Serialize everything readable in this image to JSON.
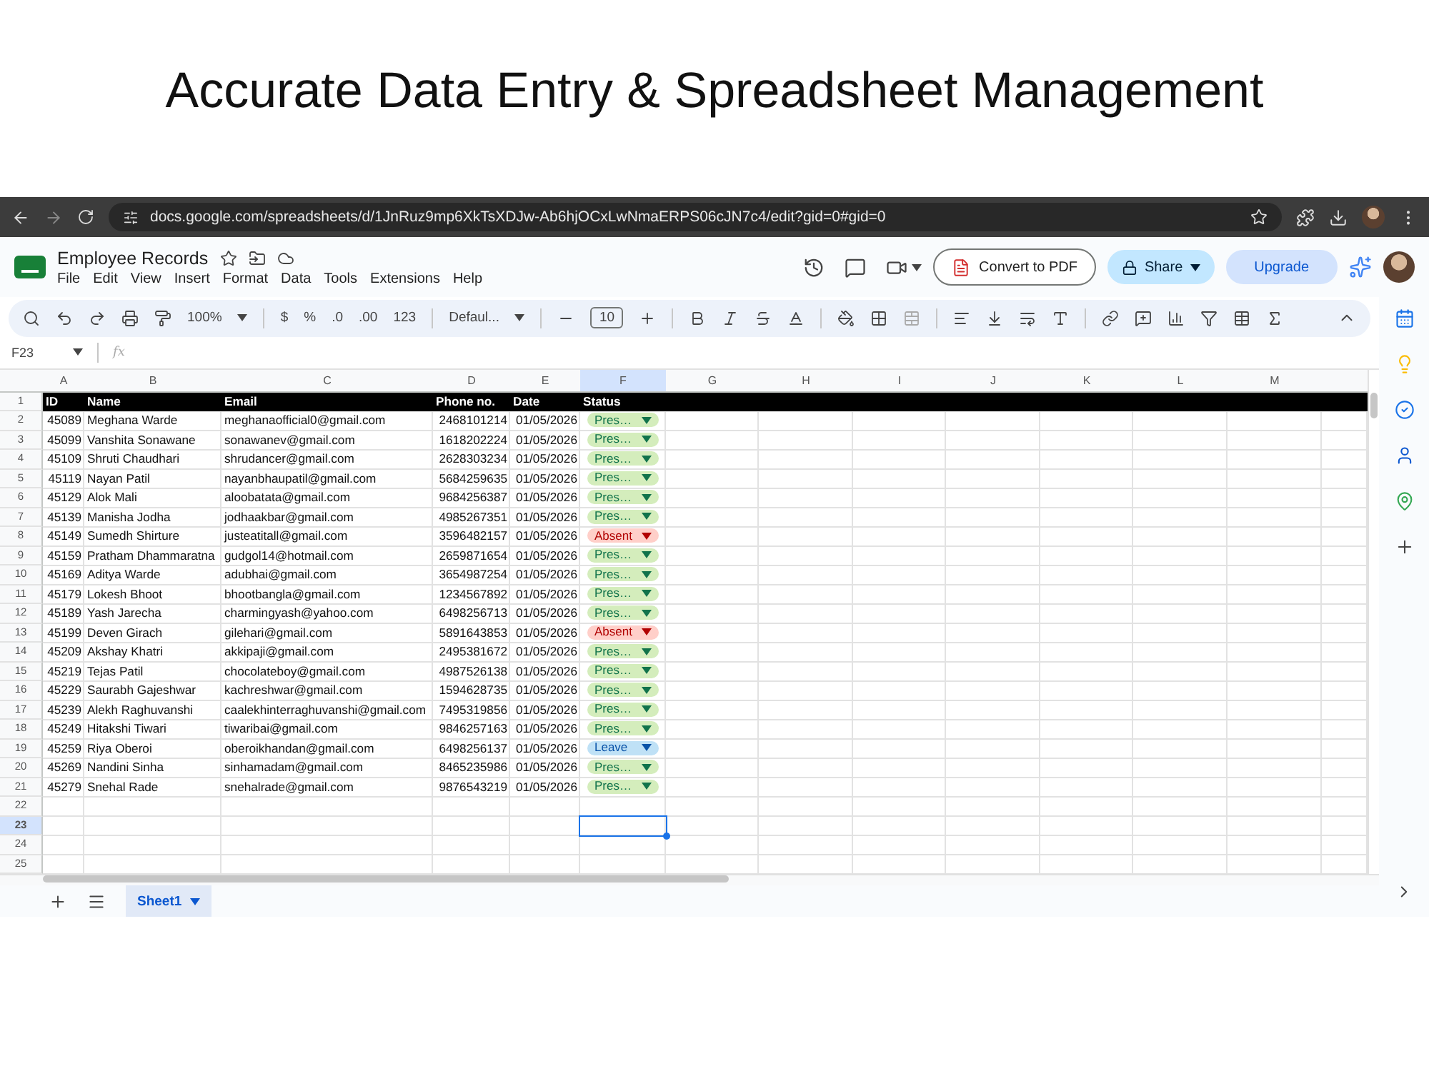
{
  "heading": "Accurate Data Entry & Spreadsheet Management",
  "browser": {
    "url": "docs.google.com/spreadsheets/d/1JnRuz9mp6XkTsXDJw-Ab6hjOCxLwNmaERPS06cJN7c4/edit?gid=0#gid=0"
  },
  "app": {
    "title": "Employee Records",
    "menu": [
      "File",
      "Edit",
      "View",
      "Insert",
      "Format",
      "Data",
      "Tools",
      "Extensions",
      "Help"
    ],
    "convert_button": "Convert to PDF",
    "share_button": "Share",
    "upgrade_button": "Upgrade"
  },
  "toolbar": {
    "zoom": "100%",
    "currency": "$",
    "percent": "%",
    "decrease_decimals": ".0",
    "increase_decimals": ".00",
    "number_format": "123",
    "font": "Defaul...",
    "font_size": "10"
  },
  "formula_bar": {
    "name_box": "F23",
    "label": "fx"
  },
  "grid": {
    "columns": [
      {
        "letter": "A",
        "selected": false
      },
      {
        "letter": "B",
        "selected": false
      },
      {
        "letter": "C",
        "selected": false
      },
      {
        "letter": "D",
        "selected": false
      },
      {
        "letter": "E",
        "selected": false
      },
      {
        "letter": "F",
        "selected": true
      },
      {
        "letter": "G",
        "selected": false
      },
      {
        "letter": "H",
        "selected": false
      },
      {
        "letter": "I",
        "selected": false
      },
      {
        "letter": "J",
        "selected": false
      },
      {
        "letter": "K",
        "selected": false
      },
      {
        "letter": "L",
        "selected": false
      },
      {
        "letter": "M",
        "selected": false
      }
    ],
    "header": {
      "number": "1",
      "cells": [
        "ID",
        "Name",
        "Email",
        "Phone no.",
        "Date",
        "Status"
      ]
    },
    "rows": [
      {
        "number": "2",
        "selected": false,
        "cells": [
          "45089",
          "Meghana Warde",
          "meghanaofficial0@gmail.com",
          "2468101214",
          "01/05/2026"
        ],
        "status": {
          "text": "Pres…",
          "kind": "present"
        }
      },
      {
        "number": "3",
        "selected": false,
        "cells": [
          "45099",
          "Vanshita Sonawane",
          "sonawanev@gmail.com",
          "1618202224",
          "01/05/2026"
        ],
        "status": {
          "text": "Pres…",
          "kind": "present"
        }
      },
      {
        "number": "4",
        "selected": false,
        "cells": [
          "45109",
          "Shruti Chaudhari",
          "shrudancer@gmail.com",
          "2628303234",
          "01/05/2026"
        ],
        "status": {
          "text": "Pres…",
          "kind": "present"
        }
      },
      {
        "number": "5",
        "selected": false,
        "cells": [
          "45119",
          "Nayan Patil",
          "nayanbhaupatil@gmail.com",
          "5684259635",
          "01/05/2026"
        ],
        "status": {
          "text": "Pres…",
          "kind": "present"
        }
      },
      {
        "number": "6",
        "selected": false,
        "cells": [
          "45129",
          "Alok Mali",
          "aloobatata@gmail.com",
          "9684256387",
          "01/05/2026"
        ],
        "status": {
          "text": "Pres…",
          "kind": "present"
        }
      },
      {
        "number": "7",
        "selected": false,
        "cells": [
          "45139",
          "Manisha Jodha",
          "jodhaakbar@gmail.com",
          "4985267351",
          "01/05/2026"
        ],
        "status": {
          "text": "Pres…",
          "kind": "present"
        }
      },
      {
        "number": "8",
        "selected": false,
        "cells": [
          "45149",
          "Sumedh Shirture",
          "justeatitall@gmail.com",
          "3596482157",
          "01/05/2026"
        ],
        "status": {
          "text": "Absent",
          "kind": "absent"
        }
      },
      {
        "number": "9",
        "selected": false,
        "cells": [
          "45159",
          "Pratham Dhammaratna",
          "gudgol14@hotmail.com",
          "2659871654",
          "01/05/2026"
        ],
        "status": {
          "text": "Pres…",
          "kind": "present"
        }
      },
      {
        "number": "10",
        "selected": false,
        "cells": [
          "45169",
          "Aditya Warde",
          "adubhai@gmail.com",
          "3654987254",
          "01/05/2026"
        ],
        "status": {
          "text": "Pres…",
          "kind": "present"
        }
      },
      {
        "number": "11",
        "selected": false,
        "cells": [
          "45179",
          "Lokesh Bhoot",
          "bhootbangla@gmail.com",
          "1234567892",
          "01/05/2026"
        ],
        "status": {
          "text": "Pres…",
          "kind": "present"
        }
      },
      {
        "number": "12",
        "selected": false,
        "cells": [
          "45189",
          "Yash Jarecha",
          "charmingyash@yahoo.com",
          "6498256713",
          "01/05/2026"
        ],
        "status": {
          "text": "Pres…",
          "kind": "present"
        }
      },
      {
        "number": "13",
        "selected": false,
        "cells": [
          "45199",
          "Deven Girach",
          "gilehari@gmail.com",
          "5891643853",
          "01/05/2026"
        ],
        "status": {
          "text": "Absent",
          "kind": "absent"
        }
      },
      {
        "number": "14",
        "selected": false,
        "cells": [
          "45209",
          "Akshay Khatri",
          "akkipaji@gmail.com",
          "2495381672",
          "01/05/2026"
        ],
        "status": {
          "text": "Pres…",
          "kind": "present"
        }
      },
      {
        "number": "15",
        "selected": false,
        "cells": [
          "45219",
          "Tejas Patil",
          "chocolateboy@gmail.com",
          "4987526138",
          "01/05/2026"
        ],
        "status": {
          "text": "Pres…",
          "kind": "present"
        }
      },
      {
        "number": "16",
        "selected": false,
        "cells": [
          "45229",
          "Saurabh Gajeshwar",
          "kachreshwar@gmail.com",
          "1594628735",
          "01/05/2026"
        ],
        "status": {
          "text": "Pres…",
          "kind": "present"
        }
      },
      {
        "number": "17",
        "selected": false,
        "cells": [
          "45239",
          "Alekh Raghuvanshi",
          "caalekhinterraghuvanshi@gmail.com",
          "7495319856",
          "01/05/2026"
        ],
        "status": {
          "text": "Pres…",
          "kind": "present"
        }
      },
      {
        "number": "18",
        "selected": false,
        "cells": [
          "45249",
          "Hitakshi Tiwari",
          "tiwaribai@gmail.com",
          "9846257163",
          "01/05/2026"
        ],
        "status": {
          "text": "Pres…",
          "kind": "present"
        }
      },
      {
        "number": "19",
        "selected": false,
        "cells": [
          "45259",
          "Riya Oberoi",
          "oberoikhandan@gmail.com",
          "6498256137",
          "01/05/2026"
        ],
        "status": {
          "text": "Leave",
          "kind": "leave"
        }
      },
      {
        "number": "20",
        "selected": false,
        "cells": [
          "45269",
          "Nandini Sinha",
          "sinhamadam@gmail.com",
          "8465235986",
          "01/05/2026"
        ],
        "status": {
          "text": "Pres…",
          "kind": "present"
        }
      },
      {
        "number": "21",
        "selected": false,
        "cells": [
          "45279",
          "Snehal Rade",
          "snehalrade@gmail.com",
          "9876543219",
          "01/05/2026"
        ],
        "status": {
          "text": "Pres…",
          "kind": "present"
        }
      },
      {
        "number": "22",
        "selected": false
      },
      {
        "number": "23",
        "selected": true
      },
      {
        "number": "24",
        "selected": false
      },
      {
        "number": "25",
        "selected": false
      }
    ]
  },
  "sheet_tabs": [
    {
      "label": "Sheet1",
      "selected": true
    }
  ]
}
